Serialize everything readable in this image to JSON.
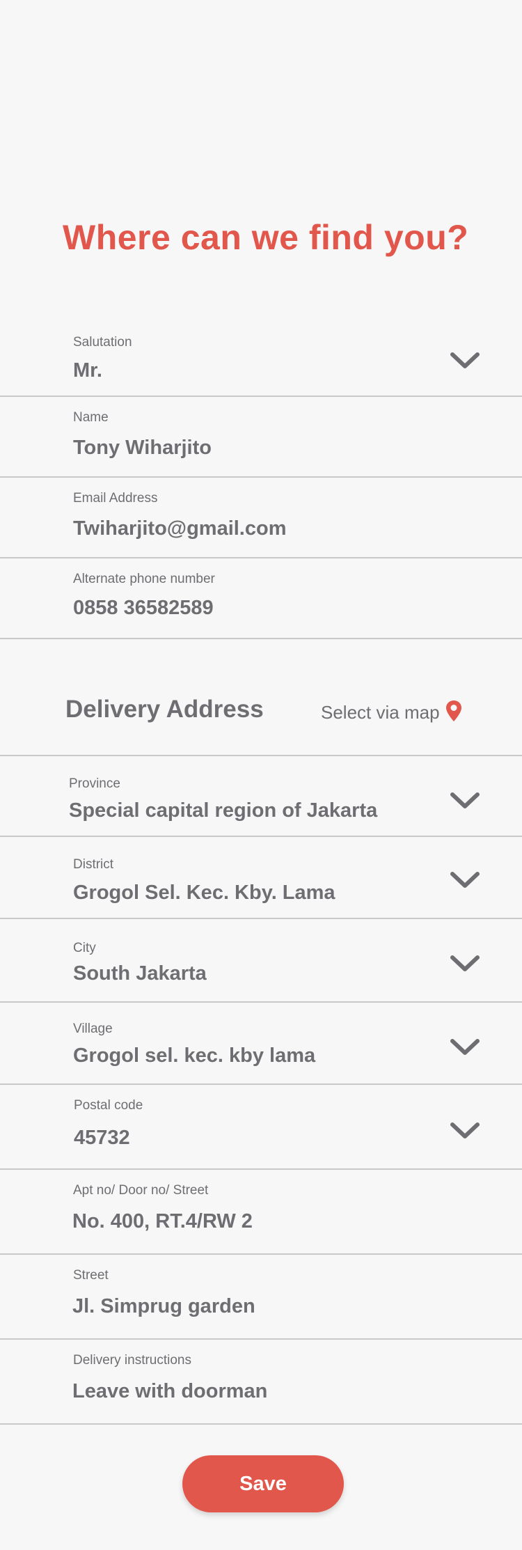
{
  "page": {
    "title": "Where can we find you?"
  },
  "contact": {
    "salutation": {
      "label": "Salutation",
      "value": "Mr."
    },
    "name": {
      "label": "Name",
      "value": "Tony Wiharjito"
    },
    "email": {
      "label": "Email Address",
      "value": "Twiharjito@gmail.com"
    },
    "phone": {
      "label": "Alternate phone number",
      "value": "0858 36582589"
    }
  },
  "delivery": {
    "title": "Delivery Address",
    "map_link": "Select via map",
    "province": {
      "label": "Province",
      "value": "Special capital region of Jakarta"
    },
    "district": {
      "label": "District",
      "value": "Grogol Sel. Kec. Kby. Lama"
    },
    "city": {
      "label": "City",
      "value": "South Jakarta"
    },
    "village": {
      "label": "Village",
      "value": "Grogol sel. kec. kby lama"
    },
    "postal": {
      "label": "Postal code",
      "value": "45732"
    },
    "apt": {
      "label": "Apt no/ Door no/ Street",
      "value": "No. 400, RT.4/RW 2"
    },
    "street": {
      "label": "Street",
      "value": "Jl. Simprug garden"
    },
    "instructions": {
      "label": "Delivery instructions",
      "value": "Leave with doorman"
    }
  },
  "actions": {
    "save_label": "Save"
  },
  "colors": {
    "accent": "#e2574c",
    "text": "#6e6e72",
    "divider": "#c9c9c9",
    "background": "#f7f7f7"
  }
}
